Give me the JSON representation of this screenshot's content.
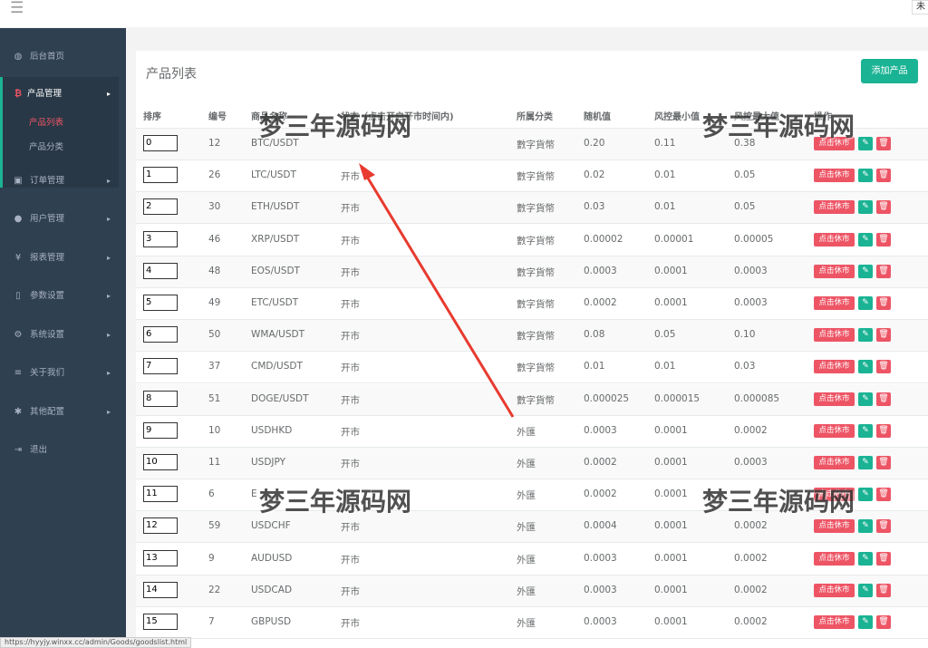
{
  "topbar": {
    "menu_icon": "hamburger-icon",
    "user_label": "未"
  },
  "sidebar": {
    "items": [
      {
        "label": "后台首页",
        "icon": "dashboard-icon",
        "glyph": "◍"
      },
      {
        "label": "产品管理",
        "icon": "bitcoin-icon",
        "glyph": "₿"
      },
      {
        "label": "订单管理",
        "icon": "copy-icon",
        "glyph": "▣"
      },
      {
        "label": "用户管理",
        "icon": "user-icon",
        "glyph": "●"
      },
      {
        "label": "报表管理",
        "icon": "yen-icon",
        "glyph": "¥"
      },
      {
        "label": "参数设置",
        "icon": "file-icon",
        "glyph": "▯"
      },
      {
        "label": "系统设置",
        "icon": "cogs-icon",
        "glyph": "⚙"
      },
      {
        "label": "关于我们",
        "icon": "list-icon",
        "glyph": "≡"
      },
      {
        "label": "其他配置",
        "icon": "gear-icon",
        "glyph": "✱"
      },
      {
        "label": "退出",
        "icon": "sign-out-icon",
        "glyph": "⇥"
      }
    ],
    "sub_items": [
      {
        "label": "产品列表"
      },
      {
        "label": "产品分类"
      }
    ]
  },
  "panel": {
    "title": "产品列表",
    "add_label": "添加产品"
  },
  "table": {
    "headers": [
      "排序",
      "编号",
      "商品名称",
      "状态（点击开启开市时间内)",
      "所属分类",
      "随机值",
      "风控最小值",
      "风控最大值",
      "操作"
    ],
    "rest_label": "点击休市",
    "rows": [
      {
        "sort": "0",
        "id": "12",
        "name": "BTC/USDT",
        "status": "",
        "category": "數字貨幣",
        "random": "0.20",
        "min": "0.11",
        "max": "0.38"
      },
      {
        "sort": "1",
        "id": "26",
        "name": "LTC/USDT",
        "status": "开市",
        "category": "數字貨幣",
        "random": "0.02",
        "min": "0.01",
        "max": "0.05"
      },
      {
        "sort": "2",
        "id": "30",
        "name": "ETH/USDT",
        "status": "开市",
        "category": "數字貨幣",
        "random": "0.03",
        "min": "0.01",
        "max": "0.05"
      },
      {
        "sort": "3",
        "id": "46",
        "name": "XRP/USDT",
        "status": "开市",
        "category": "數字貨幣",
        "random": "0.00002",
        "min": "0.00001",
        "max": "0.00005"
      },
      {
        "sort": "4",
        "id": "48",
        "name": "EOS/USDT",
        "status": "开市",
        "category": "數字貨幣",
        "random": "0.0003",
        "min": "0.0001",
        "max": "0.0003"
      },
      {
        "sort": "5",
        "id": "49",
        "name": "ETC/USDT",
        "status": "开市",
        "category": "數字貨幣",
        "random": "0.0002",
        "min": "0.0001",
        "max": "0.0003"
      },
      {
        "sort": "6",
        "id": "50",
        "name": "WMA/USDT",
        "status": "开市",
        "category": "數字貨幣",
        "random": "0.08",
        "min": "0.05",
        "max": "0.10"
      },
      {
        "sort": "7",
        "id": "37",
        "name": "CMD/USDT",
        "status": "开市",
        "category": "數字貨幣",
        "random": "0.01",
        "min": "0.01",
        "max": "0.03"
      },
      {
        "sort": "8",
        "id": "51",
        "name": "DOGE/USDT",
        "status": "开市",
        "category": "數字貨幣",
        "random": "0.000025",
        "min": "0.000015",
        "max": "0.000085"
      },
      {
        "sort": "9",
        "id": "10",
        "name": "USDHKD",
        "status": "开市",
        "category": "外匯",
        "random": "0.0003",
        "min": "0.0001",
        "max": "0.0002"
      },
      {
        "sort": "10",
        "id": "11",
        "name": "USDJPY",
        "status": "开市",
        "category": "外匯",
        "random": "0.0002",
        "min": "0.0001",
        "max": "0.0003"
      },
      {
        "sort": "11",
        "id": "6",
        "name": "E",
        "status": "",
        "category": "外匯",
        "random": "0.0002",
        "min": "0.0001",
        "max": ""
      },
      {
        "sort": "12",
        "id": "59",
        "name": "USDCHF",
        "status": "开市",
        "category": "外匯",
        "random": "0.0004",
        "min": "0.0001",
        "max": "0.0002"
      },
      {
        "sort": "13",
        "id": "9",
        "name": "AUDUSD",
        "status": "开市",
        "category": "外匯",
        "random": "0.0003",
        "min": "0.0001",
        "max": "0.0002"
      },
      {
        "sort": "14",
        "id": "22",
        "name": "USDCAD",
        "status": "开市",
        "category": "外匯",
        "random": "0.0003",
        "min": "0.0001",
        "max": "0.0002"
      },
      {
        "sort": "15",
        "id": "7",
        "name": "GBPUSD",
        "status": "开市",
        "category": "外匯",
        "random": "0.0003",
        "min": "0.0001",
        "max": "0.0002"
      }
    ]
  },
  "watermark": "梦三年源码网",
  "statusbar": "https://hyyjy.winxx.cc/admin/Goods/goodslist.html",
  "colors": {
    "sidebar": "#2f4050",
    "accent": "#1ab394",
    "danger": "#ed5565"
  }
}
